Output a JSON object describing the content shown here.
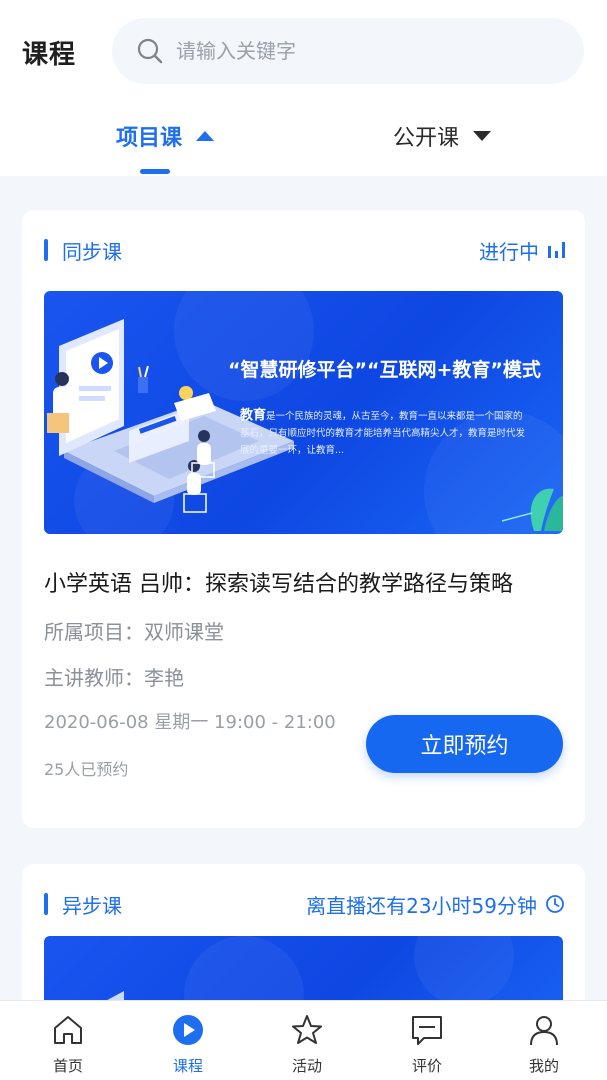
{
  "header": {
    "title": "课程",
    "search_placeholder": "请输入关键字",
    "search_value": ""
  },
  "tabs": [
    {
      "label": "项目课",
      "active": true
    },
    {
      "label": "公开课",
      "active": false
    }
  ],
  "cards": [
    {
      "tag": "同步课",
      "status": "进行中",
      "banner_headline": "“智慧研修平台”“互联网+教育”模式",
      "banner_body_lead": "教育",
      "banner_body": "是一个民族的灵魂，从古至今，教育一直以来都是一个国家的基石，只有顺应时代的教育才能培养当代高精尖人才，教育是时代发展的重要一环，让教育...",
      "title": "小学英语 吕帅：探索读写结合的教学路径与策略",
      "project": "所属项目：双师课堂",
      "teacher": "主讲教师：李艳",
      "time": "2020-06-08  星期一  19:00 - 21:00",
      "count": "25人已预约",
      "button": "立即预约"
    },
    {
      "tag": "异步课",
      "status": "离直播还有23小时59分钟"
    }
  ],
  "bottom_nav": [
    {
      "label": "首页",
      "icon": "home-icon",
      "active": false
    },
    {
      "label": "课程",
      "icon": "play-icon",
      "active": true
    },
    {
      "label": "活动",
      "icon": "star-icon",
      "active": false
    },
    {
      "label": "评价",
      "icon": "comment-icon",
      "active": false
    },
    {
      "label": "我的",
      "icon": "user-icon",
      "active": false
    }
  ],
  "colors": {
    "accent": "#1e6ff0",
    "background": "#f3f6fa",
    "muted_text": "#8b9099"
  }
}
